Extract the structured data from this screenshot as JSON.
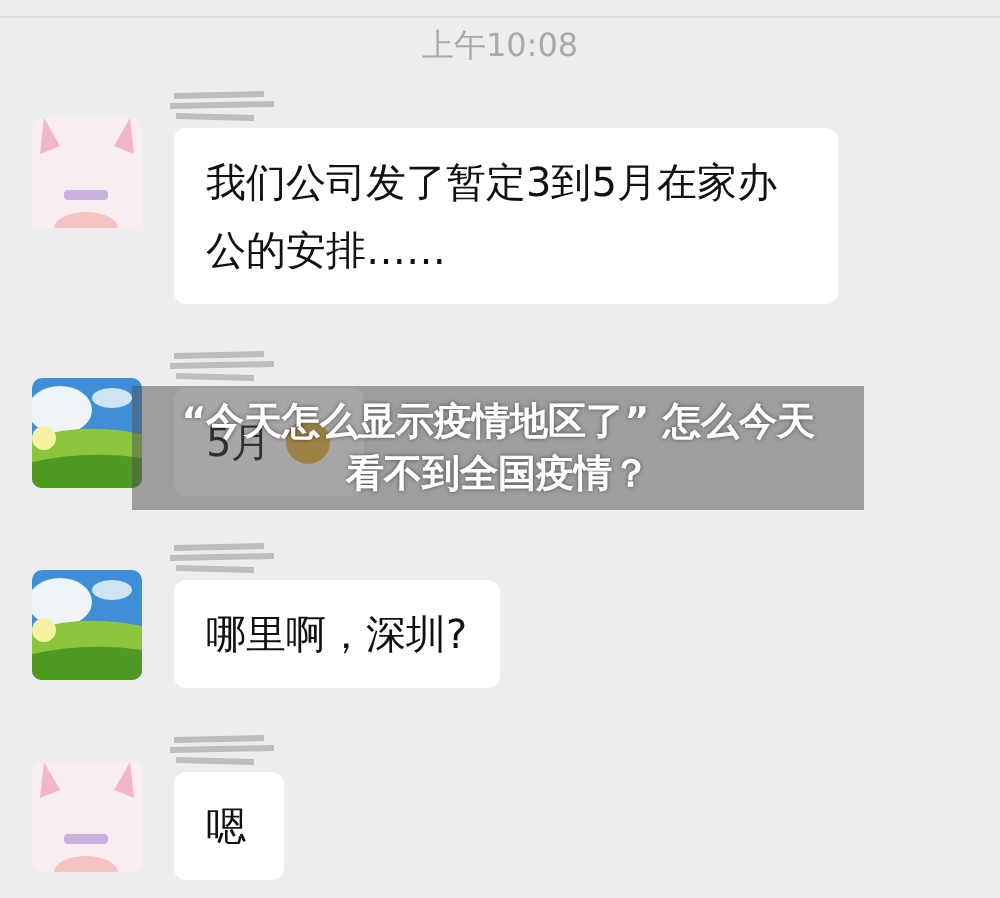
{
  "timestamp": "上午10:08",
  "messages": [
    {
      "kind": "cartoon",
      "text": "我们公司发了暂定3到5月在家办公的安排……",
      "emoji": false
    },
    {
      "kind": "picture",
      "text": "5月",
      "emoji": true
    },
    {
      "kind": "picture",
      "text": "哪里啊，深圳?",
      "emoji": false
    },
    {
      "kind": "cartoon",
      "text": "嗯",
      "emoji": false
    }
  ],
  "caption": "“今天怎么显示疫情地区了” 怎么今天看不到全国疫情？"
}
